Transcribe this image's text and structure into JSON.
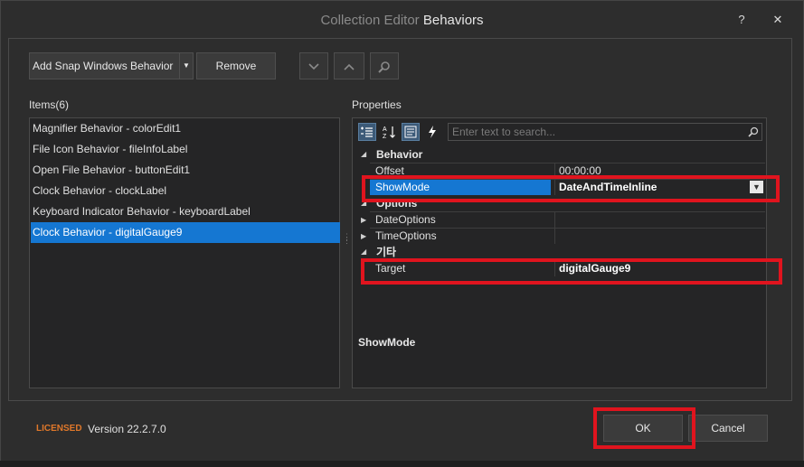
{
  "window": {
    "title_prefix": "Collection Editor",
    "title_main": "Behaviors",
    "help_label": "?",
    "close_label": "✕"
  },
  "toolbar": {
    "add_label": "Add Snap Windows Behavior",
    "add_dropdown_icon": "chevron-down",
    "remove_label": "Remove",
    "move_down_icon": "chevron-down",
    "move_up_icon": "chevron-up",
    "search_icon": "magnifier"
  },
  "items": {
    "header": "Items(6)",
    "list": [
      "Magnifier Behavior - colorEdit1",
      "File Icon Behavior - fileInfoLabel",
      "Open File Behavior - buttonEdit1",
      "Clock Behavior - clockLabel",
      "Keyboard Indicator Behavior - keyboardLabel",
      "Clock Behavior - digitalGauge9"
    ],
    "selected_index": 5
  },
  "properties": {
    "header": "Properties",
    "search_placeholder": "Enter text to search...",
    "categories": {
      "behavior": "Behavior",
      "options": "Options",
      "misc": "기타"
    },
    "rows": {
      "offset": {
        "name": "Offset",
        "value": "00:00:00"
      },
      "showmode": {
        "name": "ShowMode",
        "value": "DateAndTimeInline"
      },
      "dateoptions": {
        "name": "DateOptions",
        "value": ""
      },
      "timeoptions": {
        "name": "TimeOptions",
        "value": ""
      },
      "target": {
        "name": "Target",
        "value": "digitalGauge9"
      }
    },
    "description_title": "ShowMode"
  },
  "footer": {
    "licensed": "LICENSED",
    "version": "Version 22.2.7.0",
    "ok_label": "OK",
    "cancel_label": "Cancel"
  },
  "colors": {
    "accent": "#1577d2",
    "highlight_red": "#e0141e",
    "licensed_orange": "#e0782a"
  }
}
